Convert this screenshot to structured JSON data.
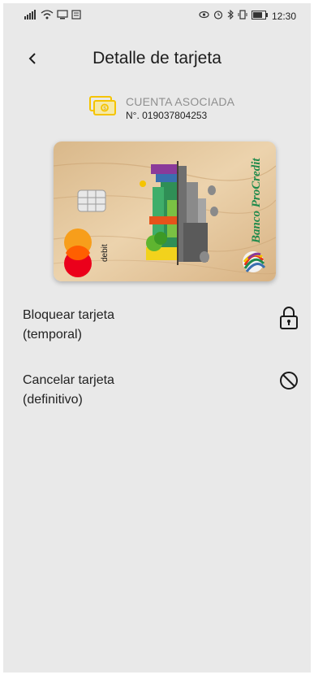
{
  "status_bar": {
    "time": "12:30"
  },
  "header": {
    "title": "Detalle de tarjeta"
  },
  "account": {
    "label": "CUENTA ASOCIADA",
    "number": "N°. 019037804253"
  },
  "card": {
    "bank_name": "Banco ProCredit",
    "type_label": "debit",
    "network": "mastercard"
  },
  "actions": [
    {
      "label": "Bloquear tarjeta\n(temporal)",
      "icon": "lock-icon"
    },
    {
      "label": "Cancelar tarjeta\n(definitivo)",
      "icon": "block-icon"
    }
  ],
  "colors": {
    "background": "#e9e9e9",
    "accent_yellow": "#f5c400",
    "bank_green": "#1f8a4c",
    "mc_red": "#eb001b",
    "mc_orange": "#f79e1b"
  }
}
